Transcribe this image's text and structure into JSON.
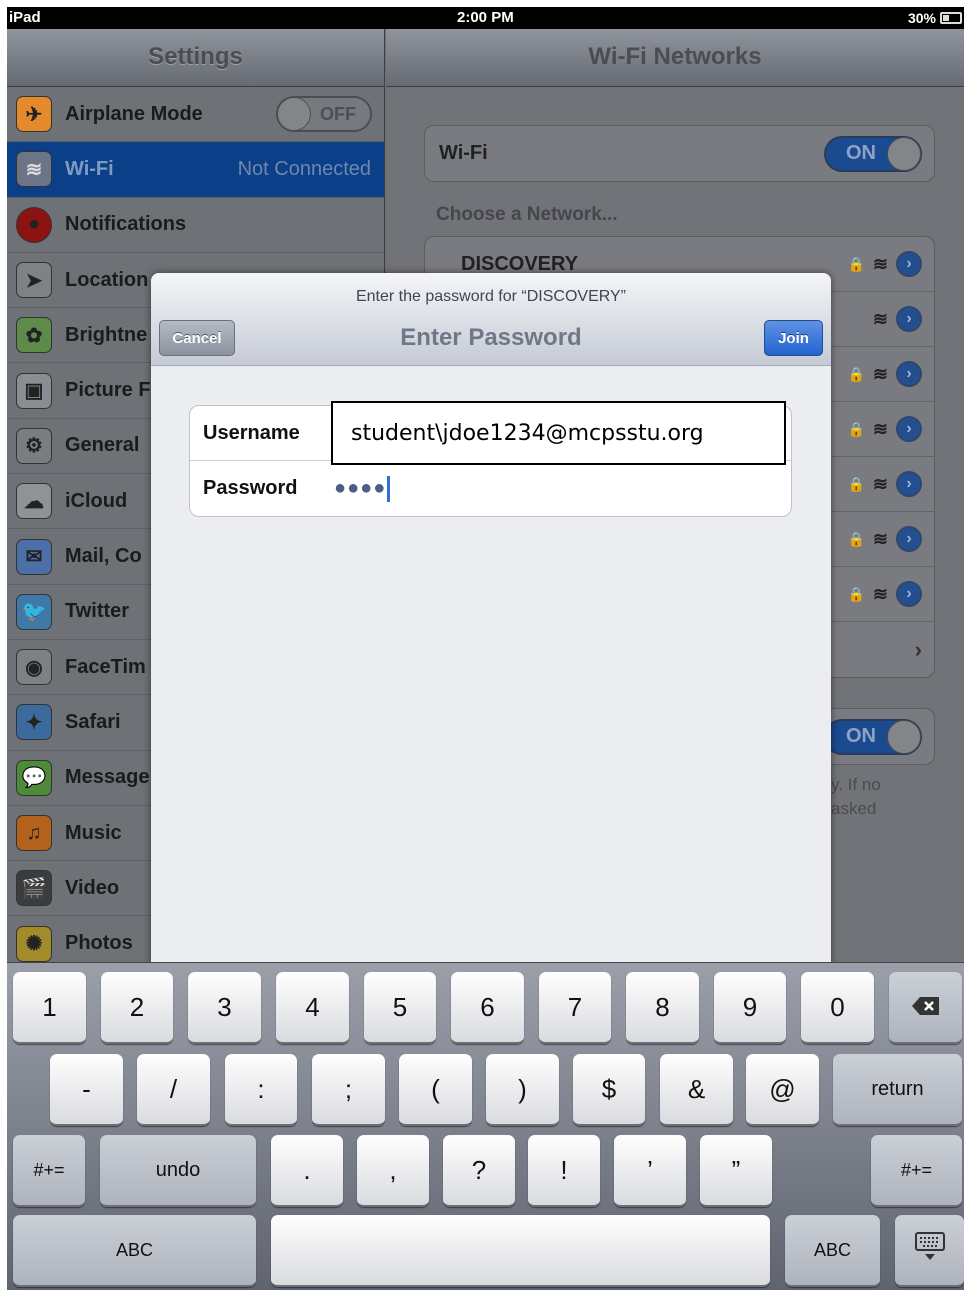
{
  "status_bar": {
    "carrier": "iPad",
    "time": "2:00 PM",
    "battery": "30%"
  },
  "settings": {
    "title": "Settings",
    "items": [
      {
        "label": "Airplane Mode",
        "icon": "airplane-icon",
        "toggle": "OFF"
      },
      {
        "label": "Wi-Fi",
        "icon": "wifi-icon",
        "value": "Not Connected"
      },
      {
        "label": "Notifications",
        "icon": "notifications-icon"
      },
      {
        "label": "Location",
        "icon": "location-icon"
      },
      {
        "label": "Brightne",
        "icon": "brightness-icon"
      },
      {
        "label": "Picture F",
        "icon": "picture-frame-icon"
      },
      {
        "label": "General",
        "icon": "gear-icon"
      },
      {
        "label": "iCloud",
        "icon": "cloud-icon"
      },
      {
        "label": "Mail, Co",
        "icon": "mail-icon"
      },
      {
        "label": "Twitter",
        "icon": "twitter-icon"
      },
      {
        "label": "FaceTim",
        "icon": "facetime-icon"
      },
      {
        "label": "Safari",
        "icon": "safari-icon"
      },
      {
        "label": "Message",
        "icon": "messages-icon"
      },
      {
        "label": "Music",
        "icon": "music-icon"
      },
      {
        "label": "Video",
        "icon": "video-icon"
      },
      {
        "label": "Photos",
        "icon": "photos-icon"
      }
    ]
  },
  "wifi": {
    "title": "Wi-Fi Networks",
    "wifi_label": "Wi-Fi",
    "wifi_toggle": "ON",
    "choose_label": "Choose a Network...",
    "first_network": "DISCOVERY",
    "ask_toggle": "ON",
    "footer_line1": "y. If no",
    "footer_line2": "asked"
  },
  "dialog": {
    "prompt": "Enter the password for “DISCOVERY”",
    "title": "Enter Password",
    "cancel": "Cancel",
    "join": "Join",
    "username_label": "Username",
    "username_value": "student\\jdoe1234@mcpsstu.org",
    "password_label": "Password",
    "password_value": "●●●●"
  },
  "keyboard": {
    "row1": [
      "1",
      "2",
      "3",
      "4",
      "5",
      "6",
      "7",
      "8",
      "9",
      "0"
    ],
    "row2": [
      "-",
      "/",
      ":",
      ";",
      "(",
      ")",
      "$",
      "&",
      "@"
    ],
    "row3": [
      ".",
      ",",
      "?",
      "!",
      "’",
      "”"
    ],
    "return": "return",
    "symbols_left": "#+=",
    "symbols_right": "#+=",
    "undo": "undo",
    "abc_left": "ABC",
    "abc_right": "ABC"
  },
  "colors": {
    "accent": "#2463d2",
    "selected_row": "#0b3f88"
  }
}
